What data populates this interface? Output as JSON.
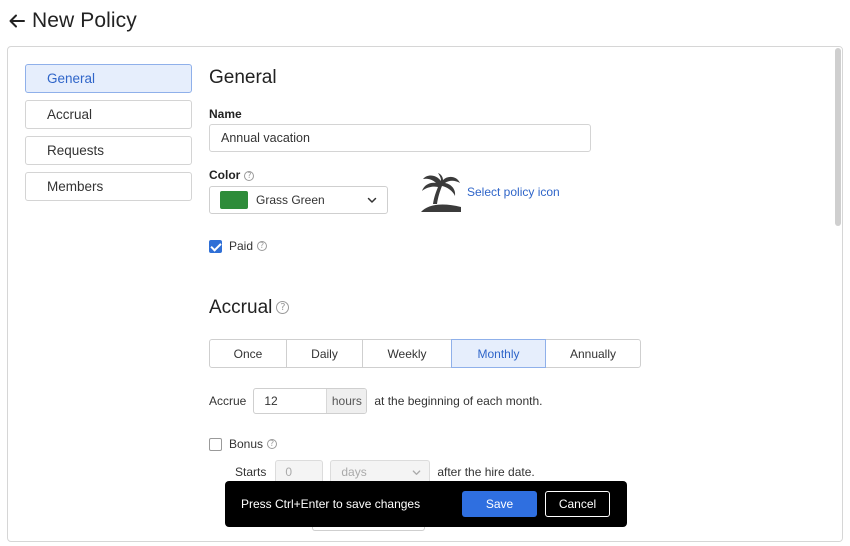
{
  "header": {
    "title": "New Policy",
    "back_icon": "arrow-left-icon"
  },
  "sidebar": {
    "items": [
      {
        "label": "General",
        "active": true
      },
      {
        "label": "Accrual",
        "active": false
      },
      {
        "label": "Requests",
        "active": false
      },
      {
        "label": "Members",
        "active": false
      }
    ]
  },
  "general": {
    "title": "General",
    "name_label": "Name",
    "name_value": "Annual vacation",
    "color_label": "Color",
    "color_value": "Grass Green",
    "color_hex": "#2e8c3a",
    "policy_icon": "palm-tree-icon",
    "select_icon_label": "Select policy icon",
    "paid_label": "Paid",
    "paid_checked": true
  },
  "accrual": {
    "title": "Accrual",
    "frequencies": [
      "Once",
      "Daily",
      "Weekly",
      "Monthly",
      "Annually"
    ],
    "selected_frequency": "Monthly",
    "accrue_label": "Accrue",
    "accrue_value": "12",
    "accrue_unit": "hours",
    "accrue_suffix": "at the beginning of each month.",
    "bonus_label": "Bonus",
    "bonus_checked": false,
    "starts_label": "Starts",
    "starts_value": "0",
    "starts_unit": "days",
    "starts_suffix": "after the hire date."
  },
  "save_bar": {
    "hint": "Press Ctrl+Enter to save changes",
    "save_label": "Save",
    "cancel_label": "Cancel"
  },
  "colors": {
    "accent": "#2f6fe0",
    "active_bg": "#e6eefc",
    "active_text": "#2f65c9"
  }
}
